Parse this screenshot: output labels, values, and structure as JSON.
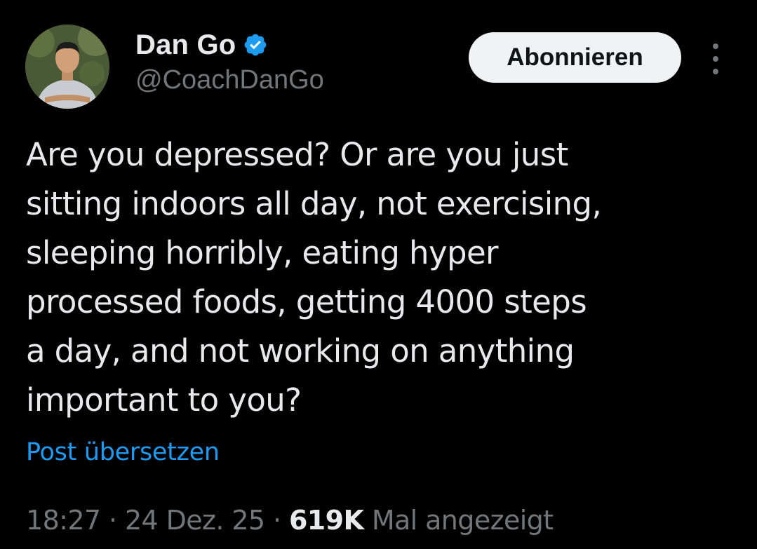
{
  "author": {
    "display_name": "Dan Go",
    "handle": "@CoachDanGo",
    "verified_icon": "verified-badge-icon"
  },
  "actions": {
    "follow_label": "Abonnieren",
    "more_icon": "more-vertical-icon"
  },
  "tweet": {
    "lines": [
      "Are you depressed? Or are you just",
      "sitting indoors all day, not exercising,",
      "sleeping horribly, eating hyper",
      "processed foods, getting 4000 steps",
      "a day, and not working on anything",
      "important to you?"
    ],
    "translate_label": "Post übersetzen"
  },
  "meta": {
    "time": "18:27",
    "separator": "·",
    "date": "24 Dez. 25",
    "views_count": "619K",
    "views_label": "Mal angezeigt"
  },
  "colors": {
    "background": "#000000",
    "text_primary": "#e7e9ea",
    "text_secondary": "#71767b",
    "accent": "#1d9bf0",
    "button_bg": "#eff3f4"
  }
}
